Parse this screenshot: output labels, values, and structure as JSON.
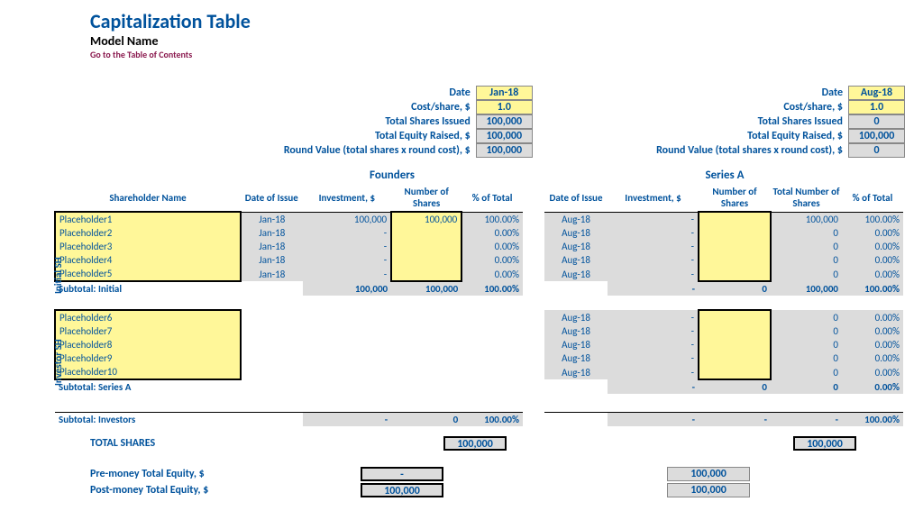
{
  "header": {
    "title": "Capitalization Table",
    "subtitle": "Model Name",
    "toc": "Go to the Table of Contents"
  },
  "rounds": {
    "founders": {
      "title": "Founders",
      "date_lab": "Date",
      "date": "Jan-18",
      "cost_lab": "Cost/share, $",
      "cost": "1.0",
      "tsi_lab": "Total Shares Issued",
      "tsi": "100,000",
      "ter_lab": "Total Equity Raised, $",
      "ter": "100,000",
      "rv_lab": "Round Value (total shares x round cost), $",
      "rv": "100,000"
    },
    "seriesa": {
      "title": "Series A",
      "date_lab": "Date",
      "date": "Aug-18",
      "cost_lab": "Cost/share, $",
      "cost": "1.0",
      "tsi_lab": "Total Shares Issued",
      "tsi": "0",
      "ter_lab": "Total Equity Raised, $",
      "ter": "100,000",
      "rv_lab": "Round Value (total shares x round cost), $",
      "rv": "0"
    }
  },
  "cols": {
    "sh": "Shareholder Name",
    "date": "Date of Issue",
    "inv": "Investment, $",
    "num": "Number of Shares",
    "tnum": "Total Number of Shares",
    "pct": "% of Total"
  },
  "vlab": {
    "initial": "Initial SH",
    "investor": "Investor SH"
  },
  "initial": [
    {
      "name": "Placeholder1",
      "f": {
        "date": "Jan-18",
        "inv": "100,000",
        "num": "100,000",
        "pct": "100.00%"
      },
      "a": {
        "date": "Aug-18",
        "inv": "-",
        "num": "",
        "tnum": "100,000",
        "pct": "100.00%"
      }
    },
    {
      "name": "Placeholder2",
      "f": {
        "date": "Jan-18",
        "inv": "-",
        "num": "",
        "pct": "0.00%"
      },
      "a": {
        "date": "Aug-18",
        "inv": "-",
        "num": "",
        "tnum": "0",
        "pct": "0.00%"
      }
    },
    {
      "name": "Placeholder3",
      "f": {
        "date": "Jan-18",
        "inv": "-",
        "num": "",
        "pct": "0.00%"
      },
      "a": {
        "date": "Aug-18",
        "inv": "-",
        "num": "",
        "tnum": "0",
        "pct": "0.00%"
      }
    },
    {
      "name": "Placeholder4",
      "f": {
        "date": "Jan-18",
        "inv": "-",
        "num": "",
        "pct": "0.00%"
      },
      "a": {
        "date": "Aug-18",
        "inv": "-",
        "num": "",
        "tnum": "0",
        "pct": "0.00%"
      }
    },
    {
      "name": "Placeholder5",
      "f": {
        "date": "Jan-18",
        "inv": "-",
        "num": "",
        "pct": "0.00%"
      },
      "a": {
        "date": "Aug-18",
        "inv": "-",
        "num": "",
        "tnum": "0",
        "pct": "0.00%"
      }
    }
  ],
  "sub_initial": {
    "lab": "Subtotal: Initial",
    "f": {
      "inv": "100,000",
      "num": "100,000",
      "pct": "100.00%"
    },
    "a": {
      "inv": "-",
      "num": "0",
      "tnum": "100,000",
      "pct": "100.00%"
    }
  },
  "investors": [
    {
      "name": "Placeholder6",
      "a": {
        "date": "Aug-18",
        "inv": "-",
        "num": "",
        "tnum": "0",
        "pct": "0.00%"
      }
    },
    {
      "name": "Placeholder7",
      "a": {
        "date": "Aug-18",
        "inv": "-",
        "num": "",
        "tnum": "0",
        "pct": "0.00%"
      }
    },
    {
      "name": "Placeholder8",
      "a": {
        "date": "Aug-18",
        "inv": "-",
        "num": "",
        "tnum": "0",
        "pct": "0.00%"
      }
    },
    {
      "name": "Placeholder9",
      "a": {
        "date": "Aug-18",
        "inv": "-",
        "num": "",
        "tnum": "0",
        "pct": "0.00%"
      }
    },
    {
      "name": "Placeholder10",
      "a": {
        "date": "Aug-18",
        "inv": "-",
        "num": "",
        "tnum": "0",
        "pct": "0.00%"
      }
    }
  ],
  "sub_seriesa": {
    "lab": "Subtotal: Series A",
    "a": {
      "inv": "-",
      "num": "0",
      "tnum": "0",
      "pct": "0.00%"
    }
  },
  "sub_investors": {
    "lab": "Subtotal: Investors",
    "f": {
      "inv": "-",
      "num": "0",
      "pct": "100.00%"
    },
    "a": {
      "inv": "-",
      "num": "-",
      "tnum": "-",
      "pct": "100.00%"
    }
  },
  "totals": {
    "shares_lab": "TOTAL SHARES",
    "shares_f": "100,000",
    "shares_a": "100,000",
    "pre_lab": "Pre-money Total Equity, $",
    "pre_f": "-",
    "pre_a": "100,000",
    "post_lab": "Post-money Total Equity, $",
    "post_f": "100,000",
    "post_a": "100,000"
  }
}
